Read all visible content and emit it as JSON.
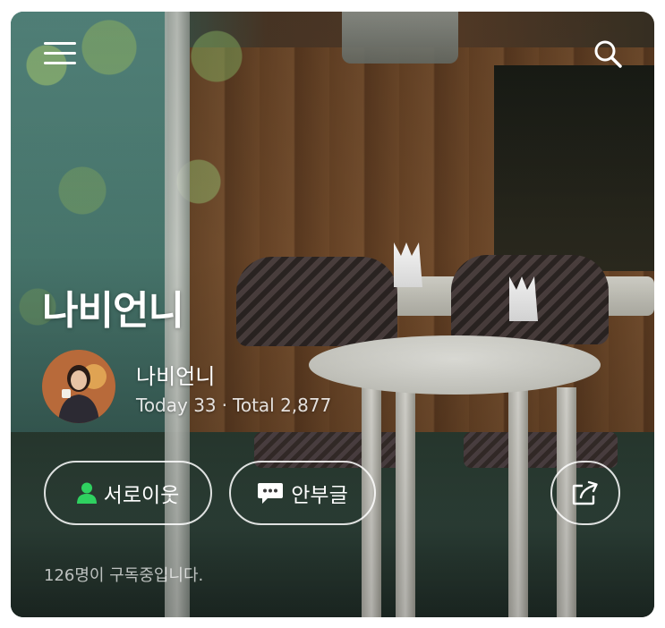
{
  "header": {
    "menu_icon": "hamburger-menu-icon",
    "search_icon": "search-icon"
  },
  "profile": {
    "blog_title": "나비언니",
    "nickname": "나비언니",
    "today_label": "Today 33",
    "separator": "·",
    "total_label": "Total 2,877"
  },
  "actions": {
    "neighbor_label": "서로이웃",
    "neighbor_icon": "person-icon",
    "neighbor_icon_color": "#2fd160",
    "guestbook_label": "안부글",
    "guestbook_icon": "speech-bubble-icon",
    "share_icon": "share-icon"
  },
  "footer": {
    "subscribers_text": "126명이 구독중입니다."
  }
}
